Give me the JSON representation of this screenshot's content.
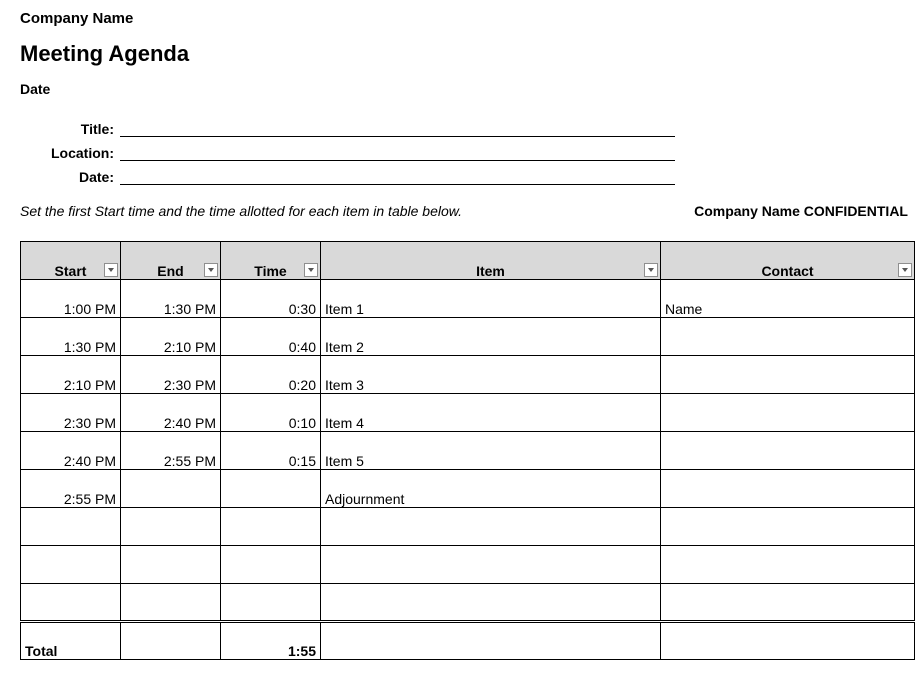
{
  "header": {
    "company_name": "Company Name",
    "doc_title": "Meeting Agenda",
    "date_label": "Date"
  },
  "meta": {
    "title_label": "Title:",
    "location_label": "Location:",
    "date_label": "Date:",
    "title_value": "",
    "location_value": "",
    "date_value": ""
  },
  "instructions": "Set the first Start time and the time allotted for each item in table below.",
  "confidential": "Company Name CONFIDENTIAL",
  "columns": {
    "start": "Start",
    "end": "End",
    "time": "Time",
    "item": "Item",
    "contact": "Contact"
  },
  "rows": [
    {
      "start": "1:00 PM",
      "end": "1:30 PM",
      "time": "0:30",
      "item": "Item 1",
      "contact": "Name"
    },
    {
      "start": "1:30 PM",
      "end": "2:10 PM",
      "time": "0:40",
      "item": "Item 2",
      "contact": ""
    },
    {
      "start": "2:10 PM",
      "end": "2:30 PM",
      "time": "0:20",
      "item": "Item 3",
      "contact": ""
    },
    {
      "start": "2:30 PM",
      "end": "2:40 PM",
      "time": "0:10",
      "item": "Item 4",
      "contact": ""
    },
    {
      "start": "2:40 PM",
      "end": "2:55 PM",
      "time": "0:15",
      "item": "Item 5",
      "contact": ""
    },
    {
      "start": "2:55 PM",
      "end": "",
      "time": "",
      "item": "Adjournment",
      "contact": ""
    },
    {
      "start": "",
      "end": "",
      "time": "",
      "item": "",
      "contact": ""
    },
    {
      "start": "",
      "end": "",
      "time": "",
      "item": "",
      "contact": ""
    },
    {
      "start": "",
      "end": "",
      "time": "",
      "item": "",
      "contact": ""
    }
  ],
  "total": {
    "label": "Total",
    "time": "1:55"
  }
}
